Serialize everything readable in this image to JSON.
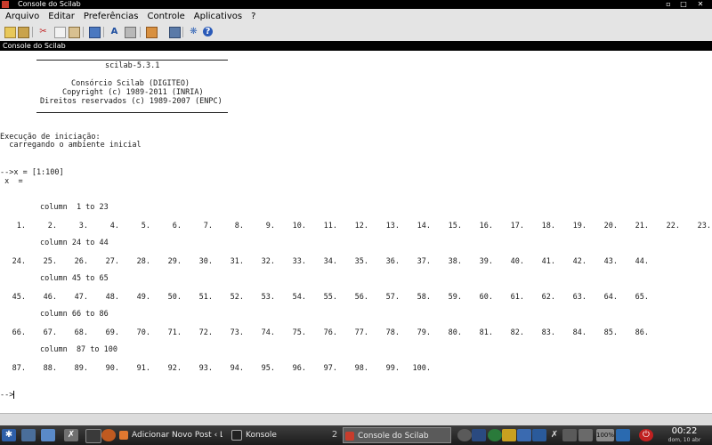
{
  "window": {
    "title": "Console do Scilab"
  },
  "menu": [
    "Arquivo",
    "Editar",
    "Preferências",
    "Controle",
    "Aplicativos",
    "?"
  ],
  "toolbar": [
    "new-file-icon",
    "open-file-icon",
    "cut-icon",
    "copy-icon",
    "paste-icon",
    "folder-icon",
    "font-icon",
    "print-icon",
    "variable-browser-icon",
    "console-icon",
    "module-manager-icon",
    "help-icon"
  ],
  "console": {
    "header": "Console do Scilab",
    "banner": {
      "version": "scilab-5.3.1",
      "consortium": "Consórcio Scilab (DIGITEO)",
      "copyright": "Copyright (c) 1989-2011 (INRIA)",
      "rights": "Direitos reservados (c) 1989-2007 (ENPC)"
    },
    "startup": {
      "line1": "Execução de iniciação:",
      "line2": "  carregando o ambiente inicial"
    },
    "command": "-->x = [1:100]",
    "result_label": " x  =",
    "blocks": [
      {
        "header": "column  1 to 23",
        "values": [
          "1.",
          "2.",
          "3.",
          "4.",
          "5.",
          "6.",
          "7.",
          "8.",
          "9.",
          "10.",
          "11.",
          "12.",
          "13.",
          "14.",
          "15.",
          "16.",
          "17.",
          "18.",
          "19.",
          "20.",
          "21.",
          "22.",
          "23."
        ]
      },
      {
        "header": "column 24 to 44",
        "values": [
          "24.",
          "25.",
          "26.",
          "27.",
          "28.",
          "29.",
          "30.",
          "31.",
          "32.",
          "33.",
          "34.",
          "35.",
          "36.",
          "37.",
          "38.",
          "39.",
          "40.",
          "41.",
          "42.",
          "43.",
          "44."
        ]
      },
      {
        "header": "column 45 to 65",
        "values": [
          "45.",
          "46.",
          "47.",
          "48.",
          "49.",
          "50.",
          "51.",
          "52.",
          "53.",
          "54.",
          "55.",
          "56.",
          "57.",
          "58.",
          "59.",
          "60.",
          "61.",
          "62.",
          "63.",
          "64.",
          "65."
        ]
      },
      {
        "header": "column 66 to 86",
        "values": [
          "66.",
          "67.",
          "68.",
          "69.",
          "70.",
          "71.",
          "72.",
          "73.",
          "74.",
          "75.",
          "76.",
          "77.",
          "78.",
          "79.",
          "80.",
          "81.",
          "82.",
          "83.",
          "84.",
          "85.",
          "86."
        ]
      },
      {
        "header": "column  87 to 100",
        "values": [
          "87.",
          "88.",
          "89.",
          "90.",
          "91.",
          "92.",
          "93.",
          "94.",
          "95.",
          "96.",
          "97.",
          "98.",
          "99.",
          "100."
        ]
      }
    ],
    "prompt": "-->"
  },
  "taskbar": {
    "tasks": [
      {
        "label": "Adicionar Novo Post ‹ Lib",
        "active": false
      },
      {
        "label": "Konsole",
        "active": false
      },
      {
        "label": "Console do Scilab",
        "active": true
      }
    ],
    "desktop_pager": "2",
    "battery": "100%",
    "clock": {
      "time": "00:22",
      "date": "dom, 10 abr"
    }
  }
}
